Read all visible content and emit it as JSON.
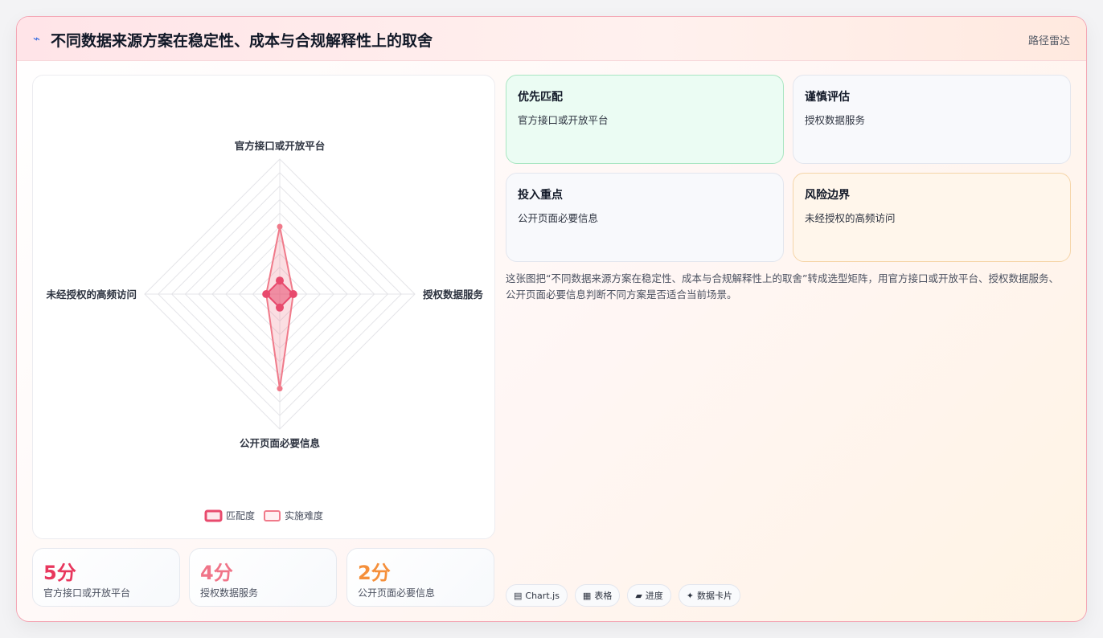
{
  "header": {
    "icon": "lightning-icon",
    "title": "不同数据来源方案在稳定性、成本与合规解释性上的取舍",
    "tag": "路径雷达"
  },
  "chart_data": {
    "type": "radar",
    "axes": [
      "官方接口或开放平台",
      "授权数据服务",
      "公开页面必要信息",
      "未经授权的高频访问"
    ],
    "rmax": 10,
    "levels": 10,
    "series": [
      {
        "name": "匹配度",
        "values": [
          1,
          1,
          1,
          1
        ],
        "color": "#e84a6d"
      },
      {
        "name": "实施难度",
        "values": [
          5,
          1,
          7,
          1
        ],
        "color": "#f07a8a"
      }
    ],
    "legend": "bottom",
    "grid": true
  },
  "stats": [
    {
      "value": "5分",
      "label": "官方接口或开放平台",
      "color": "#e8375d"
    },
    {
      "value": "4分",
      "label": "授权数据服务",
      "color": "#f07488"
    },
    {
      "value": "2分",
      "label": "公开页面必要信息",
      "color": "#f58f3a"
    }
  ],
  "tiles": [
    {
      "title": "优先匹配",
      "sub": "官方接口或开放平台"
    },
    {
      "title": "谨慎评估",
      "sub": "授权数据服务"
    },
    {
      "title": "投入重点",
      "sub": "公开页面必要信息"
    },
    {
      "title": "风险边界",
      "sub": "未经授权的高频访问"
    }
  ],
  "description": "这张图把“不同数据来源方案在稳定性、成本与合规解释性上的取舍”转成选型矩阵，用官方接口或开放平台、授权数据服务、公开页面必要信息判断不同方案是否适合当前场景。",
  "pills": [
    {
      "icon": "chart-icon",
      "glyph": "▤",
      "label": "Chart.js"
    },
    {
      "icon": "table-icon",
      "glyph": "▦",
      "label": "表格"
    },
    {
      "icon": "progress-icon",
      "glyph": "▰",
      "label": "进度"
    },
    {
      "icon": "sparkle-icon",
      "glyph": "✦",
      "label": "数据卡片"
    }
  ]
}
